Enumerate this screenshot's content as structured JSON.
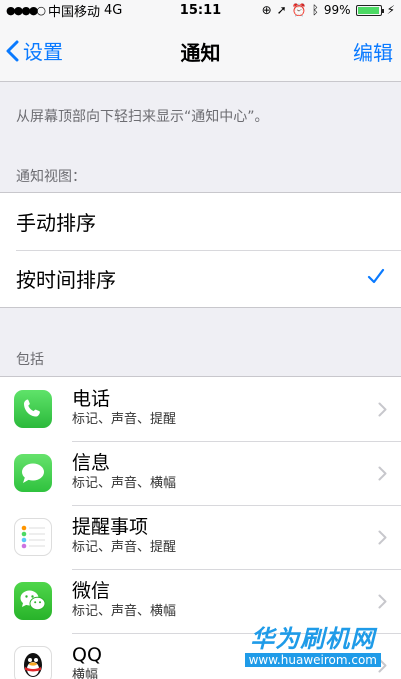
{
  "status": {
    "carrier": "中国移动",
    "network": "4G",
    "time": "15:11",
    "battery_text": "99%",
    "battery_level": 0.99
  },
  "nav": {
    "back_label": "设置",
    "title": "通知",
    "edit_label": "编辑"
  },
  "hint": "从屏幕顶部向下轻扫来显示“通知中心”。",
  "view_section": {
    "label": "通知视图：",
    "options": [
      {
        "label": "手动排序",
        "checked": false
      },
      {
        "label": "按时间排序",
        "checked": true
      }
    ]
  },
  "include_section": {
    "label": "包括",
    "apps": [
      {
        "name": "电话",
        "detail": "标记、声音、提醒",
        "icon": "phone-icon"
      },
      {
        "name": "信息",
        "detail": "标记、声音、横幅",
        "icon": "messages-icon"
      },
      {
        "name": "提醒事项",
        "detail": "标记、声音、提醒",
        "icon": "reminders-icon"
      },
      {
        "name": "微信",
        "detail": "标记、声音、横幅",
        "icon": "wechat-icon"
      },
      {
        "name": "QQ",
        "detail": "横幅",
        "icon": "qq-icon"
      }
    ]
  },
  "watermark": {
    "title": "华为刷机网",
    "url": "www.huaweirom.com"
  },
  "colors": {
    "accent": "#0a7aff",
    "checkmark": "#0a7aff",
    "watermark": "#1f9be8"
  }
}
